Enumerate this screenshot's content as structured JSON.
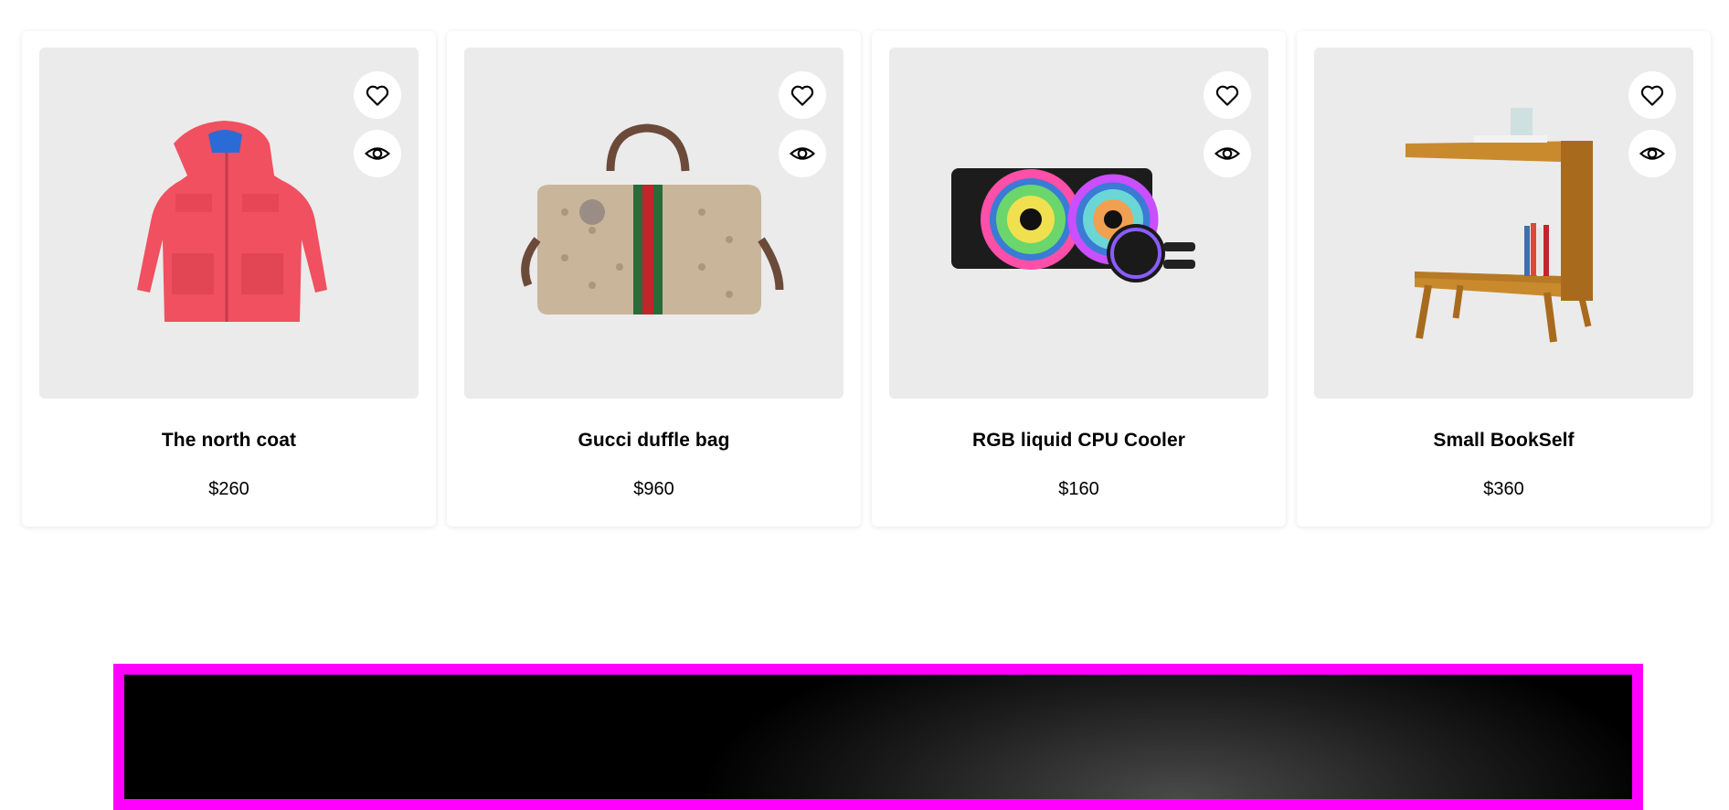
{
  "products": [
    {
      "name": "The north coat",
      "price": "$260",
      "image": "red-hooded-coat"
    },
    {
      "name": "Gucci duffle bag",
      "price": "$960",
      "image": "monogram-duffle-bag"
    },
    {
      "name": "RGB liquid CPU Cooler",
      "price": "$160",
      "image": "rgb-cpu-cooler"
    },
    {
      "name": "Small BookSelf",
      "price": "$360",
      "image": "wooden-side-bookshelf"
    }
  ],
  "icons": {
    "wishlist": "heart-icon",
    "quick_view": "eye-icon"
  },
  "colors": {
    "card_media_bg": "#ebebeb",
    "banner_border": "#ff00ff",
    "banner_bg": "#000000"
  }
}
